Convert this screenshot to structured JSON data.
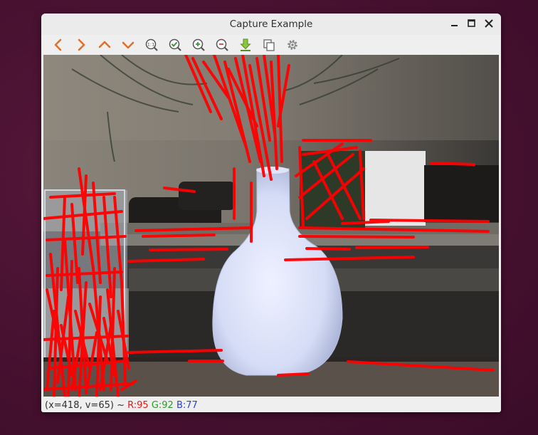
{
  "window": {
    "title": "Capture Example",
    "controls": [
      "minimize",
      "maximize",
      "close"
    ]
  },
  "toolbar": {
    "buttons": [
      {
        "name": "pan-left",
        "icon": "arrow-left-icon"
      },
      {
        "name": "pan-right",
        "icon": "arrow-right-icon"
      },
      {
        "name": "pan-up",
        "icon": "arrow-up-icon"
      },
      {
        "name": "pan-down",
        "icon": "arrow-down-icon"
      },
      {
        "name": "zoom-original",
        "icon": "zoom-original-icon"
      },
      {
        "name": "zoom-fit",
        "icon": "zoom-fit-icon"
      },
      {
        "name": "zoom-in",
        "icon": "zoom-in-icon"
      },
      {
        "name": "zoom-out",
        "icon": "zoom-out-icon"
      },
      {
        "name": "save-image",
        "icon": "download-icon"
      },
      {
        "name": "copy-image",
        "icon": "copy-icon"
      },
      {
        "name": "properties",
        "icon": "gear-icon"
      }
    ]
  },
  "status": {
    "coords": "(x=418, v=65) ~",
    "r": "R:95",
    "g": "G:92",
    "b": "B:77"
  },
  "colors": {
    "accent_orange": "#e0702a",
    "confirm_green": "#3a9b3a",
    "save_green": "#8cc63f",
    "overlay_lines": "#ff0000"
  }
}
